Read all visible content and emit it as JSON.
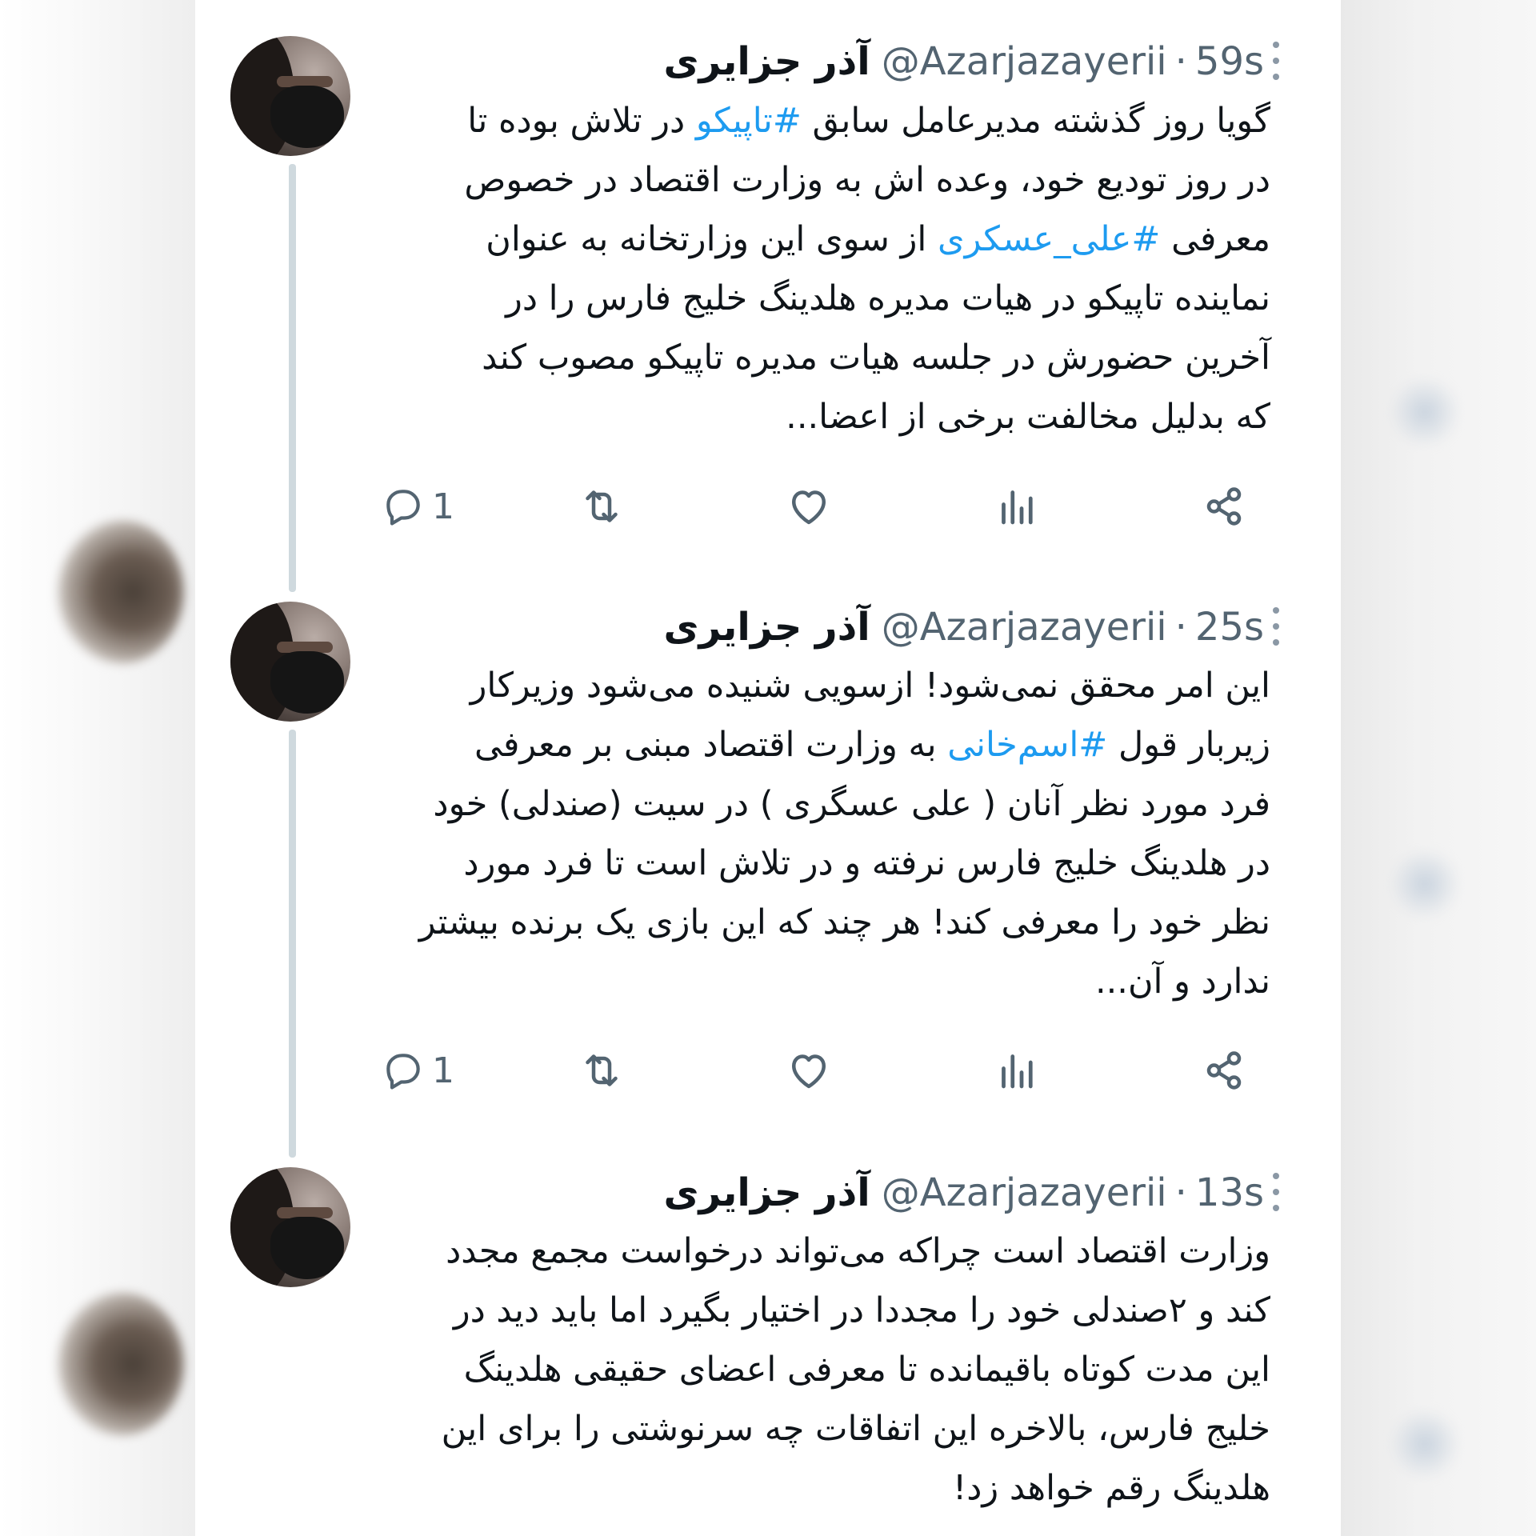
{
  "colors": {
    "accent": "#1d9bf0",
    "secondary_text": "#536471",
    "primary_text": "#0f1419",
    "icon_gray": "#536471",
    "thread_line": "#cfd9de"
  },
  "tweets": [
    {
      "display_name": "آذر جزایری",
      "handle": "@Azarjazayerii",
      "separator": "·",
      "time": "59s",
      "lines": [
        {
          "pre": "گویا روز گذشته مدیرعامل سابق ",
          "tag": "#تاپیکو",
          "post": " در تلاش بوده تا"
        },
        {
          "pre": "در روز تودیع خود، وعده اش به وزارت اقتصاد در خصوص",
          "tag": "",
          "post": ""
        },
        {
          "pre": "معرفی ",
          "tag": "#علی_عسکری",
          "post": " از سوی این وزارتخانه به عنوان"
        },
        {
          "pre": "نماینده تاپیکو در هیات مدیره هلدینگ خلیج فارس را در",
          "tag": "",
          "post": ""
        },
        {
          "pre": "آخرین حضورش در جلسه هیات مدیره تاپیکو مصوب کند",
          "tag": "",
          "post": ""
        },
        {
          "pre": "که بدلیل مخالفت برخی از اعضا...",
          "tag": "",
          "post": ""
        }
      ],
      "reply_count": "1"
    },
    {
      "display_name": "آذر جزایری",
      "handle": "@Azarjazayerii",
      "separator": "·",
      "time": "25s",
      "lines": [
        {
          "pre": "این امر محقق نمی‌شود! ازسویی شنیده می‌شود وزیرکار",
          "tag": "",
          "post": ""
        },
        {
          "pre": "زیربار قول ",
          "tag": "#اسم‌خانی",
          "post": " به وزارت اقتصاد مبنی بر معرفی"
        },
        {
          "pre": "فرد مورد نظر آنان ( علی عسگری ) در سیت (صندلی) خود",
          "tag": "",
          "post": ""
        },
        {
          "pre": "در هلدینگ خلیج فارس نرفته و در تلاش است تا فرد مورد",
          "tag": "",
          "post": ""
        },
        {
          "pre": "نظر خود را معرفی کند! هر چند که این بازی یک برنده بیشتر",
          "tag": "",
          "post": ""
        },
        {
          "pre": "ندارد و آن...",
          "tag": "",
          "post": ""
        }
      ],
      "reply_count": "1"
    },
    {
      "display_name": "آذر جزایری",
      "handle": "@Azarjazayerii",
      "separator": "·",
      "time": "13s",
      "lines": [
        {
          "pre": "وزارت اقتصاد است چراکه می‌تواند درخواست مجمع مجدد",
          "tag": "",
          "post": ""
        },
        {
          "pre": "کند و ۲صندلی خود را مجددا در اختیار بگیرد اما باید دید در",
          "tag": "",
          "post": ""
        },
        {
          "pre": "این مدت کوتاه باقیمانده تا معرفی اعضای حقیقی هلدینگ",
          "tag": "",
          "post": ""
        },
        {
          "pre": "خلیج فارس، بالاخره این اتفاقات چه سرنوشتی را برای این",
          "tag": "",
          "post": ""
        },
        {
          "pre": "هلدینگ رقم خواهد زد!",
          "tag": "",
          "post": ""
        }
      ]
    }
  ],
  "icons": {
    "reply": "reply-icon",
    "retweet": "retweet-icon",
    "like": "like-icon",
    "views": "views-icon",
    "share": "share-icon",
    "more": "more-icon"
  }
}
